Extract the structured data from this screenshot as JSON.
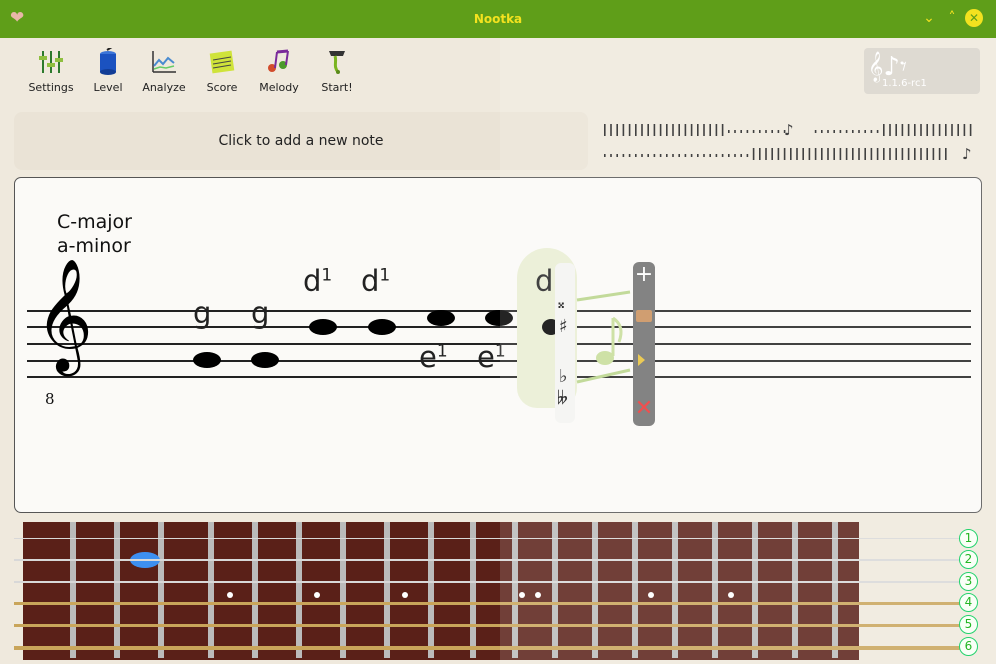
{
  "window": {
    "title": "Nootka",
    "controls": [
      "⌄",
      "˄",
      "✕"
    ]
  },
  "toolbar": {
    "buttons": [
      {
        "label": "Settings",
        "icon": "settings-icon"
      },
      {
        "label": "Level",
        "icon": "level-icon"
      },
      {
        "label": "Analyze",
        "icon": "analyze-icon"
      },
      {
        "label": "Score",
        "icon": "score-icon"
      },
      {
        "label": "Melody",
        "icon": "melody-icon"
      },
      {
        "label": "Start!",
        "icon": "start-icon"
      }
    ]
  },
  "logo": {
    "version": "1.1.6-rc1"
  },
  "hint": {
    "text": "Click to add a new note"
  },
  "score": {
    "key_major": "C-major",
    "key_minor": "a-minor",
    "clef_octave": "8",
    "notes": [
      {
        "name": "g",
        "octave": ""
      },
      {
        "name": "g",
        "octave": ""
      },
      {
        "name": "d",
        "octave": "1"
      },
      {
        "name": "d",
        "octave": "1"
      },
      {
        "name": "e",
        "octave": "1"
      },
      {
        "name": "e",
        "octave": "1"
      },
      {
        "name": "d",
        "octave": "1"
      }
    ],
    "accidentals": [
      "𝄪",
      "♯",
      "♭",
      "𝄫"
    ],
    "tools": [
      "+",
      "✕"
    ]
  },
  "fretboard": {
    "string_numbers": [
      "1",
      "2",
      "3",
      "4",
      "5",
      "6"
    ]
  },
  "colors": {
    "titlebar": "#5f9e19",
    "title_text": "#f3e21f",
    "finger_marker": "#3d8ff0"
  }
}
